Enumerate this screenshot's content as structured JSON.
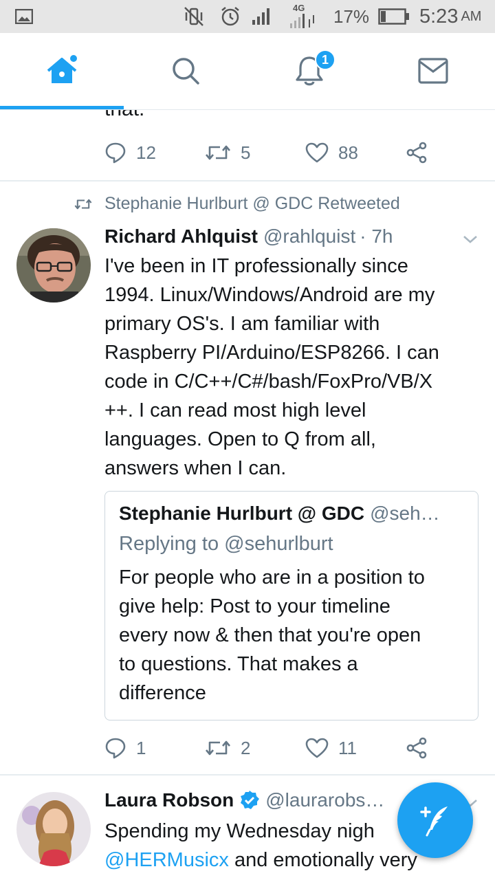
{
  "status_bar": {
    "network_label": "4G",
    "battery_percent": "17%",
    "time": "5:23",
    "ampm": "AM"
  },
  "nav": {
    "tabs": [
      "home",
      "search",
      "notifications",
      "messages"
    ],
    "active_tab": "home",
    "notification_badge": "1",
    "accent_color": "#1da1f2"
  },
  "feed": {
    "prev_tweet": {
      "cut_text": "that.",
      "replies": "12",
      "retweets": "5",
      "likes": "88"
    },
    "tweet": {
      "retweeted_by": "Stephanie Hurlburt @ GDC Retweeted",
      "name": "Richard Ahlquist",
      "handle": "@rahlquist",
      "time": "· 7h",
      "lines": [
        "I've been in IT professionally since",
        "1994. Linux/Windows/Android are my",
        "primary OS's. I am familiar with",
        "Raspberry PI/Arduino/ESP8266. I can",
        "code in C/C++/C#/bash/FoxPro/VB/X",
        "++. I can read most high level",
        "languages. Open to Q from all,",
        "answers when I can."
      ],
      "quote": {
        "name": "Stephanie Hurlburt @ GDC",
        "handle": "@seh…",
        "replying_to": "Replying to @sehurlburt",
        "lines": [
          "For people who are in a position to",
          "give help: Post to your timeline",
          "every now & then that you're open",
          "to questions. That makes a",
          "difference"
        ]
      },
      "replies": "1",
      "retweets": "2",
      "likes": "11"
    },
    "next_tweet": {
      "name": "Laura Robson",
      "handle": "@laurarobs…",
      "line1": "Spending my Wednesday nigh",
      "line2_mention": "@HERMusicx",
      "line2_rest": " and emotionally very"
    }
  }
}
